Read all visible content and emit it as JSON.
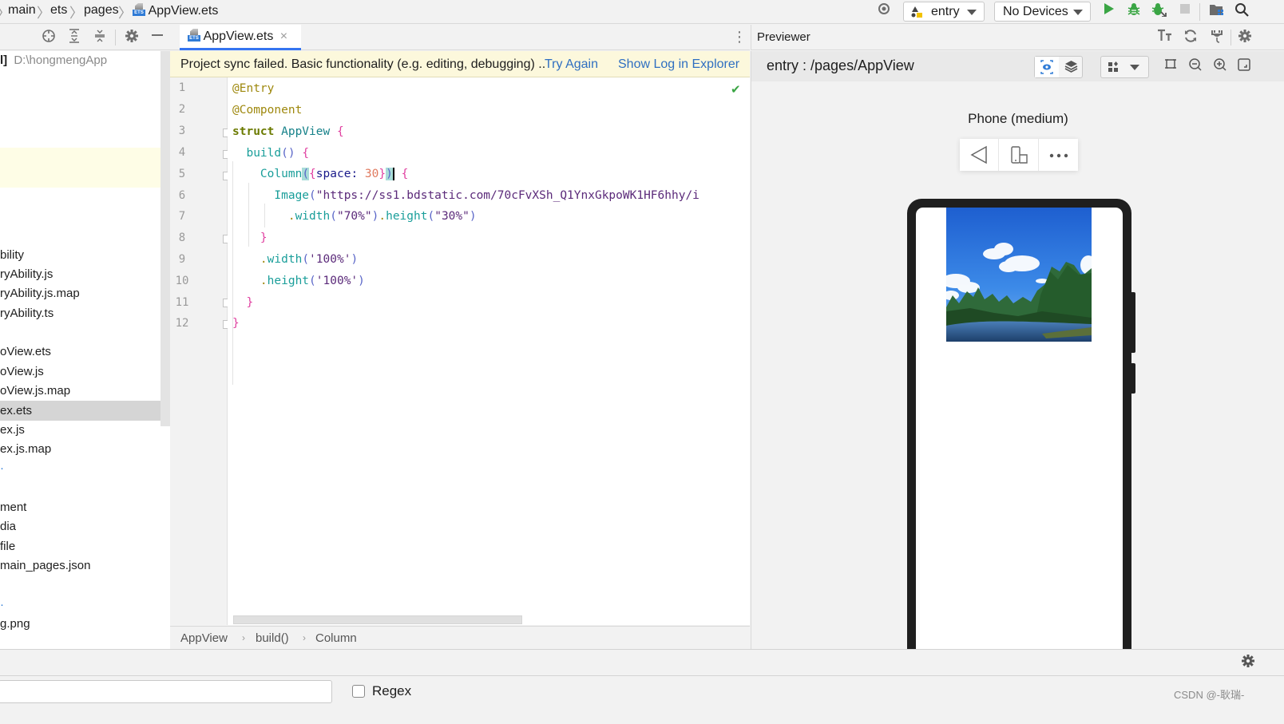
{
  "topbar": {
    "breadcrumb": [
      "main",
      "ets",
      "pages",
      "AppView.ets"
    ],
    "run_config": "entry",
    "device": "No Devices",
    "icons": [
      "target-icon",
      "run-icon",
      "debug-icon",
      "attach-debug-icon",
      "stop-icon",
      "project-structure-icon",
      "search-icon"
    ]
  },
  "sidebar": {
    "toolbar_icons": [
      "locate-icon",
      "expand-all-icon",
      "collapse-all-icon",
      "gear-icon",
      "minimize-icon"
    ],
    "root": {
      "name_fragment": "l]",
      "path": "D:\\hongmengApp"
    },
    "items": [
      "bility",
      "ryAbility.js",
      "ryAbility.js.map",
      "ryAbility.ts",
      "",
      "oView.ets",
      "oView.js",
      "oView.js.map",
      "ex.ets",
      "ex.js",
      "ex.js.map",
      "",
      "",
      "ment",
      "dia",
      "file",
      "main_pages.json",
      "",
      "",
      "g.png"
    ],
    "selected": "ex.ets"
  },
  "editor": {
    "tab": {
      "label": "AppView.ets",
      "close": "×"
    },
    "more_icon": "⋮",
    "banner": {
      "message": "Project sync failed. Basic functionality (e.g. editing, debugging) ..",
      "try_again": "Try Again",
      "show_log": "Show Log in Explorer"
    },
    "line_numbers": [
      "1",
      "2",
      "3",
      "4",
      "5",
      "6",
      "7",
      "8",
      "9",
      "10",
      "11",
      "12"
    ],
    "code": {
      "l1": "@Entry",
      "l2": "@Component",
      "l3_kw": "struct",
      "l3_name": " AppView ",
      "l3_br": "{",
      "l4_fn": "build",
      "l4_p": "()",
      "l4_br": " {",
      "l5_fn": "Column",
      "l5_p1": "(",
      "l5_b1": "{",
      "l5_key": "space",
      "l5_colon": ": ",
      "l5_num": "30",
      "l5_b2": "}",
      "l5_p2": ")",
      "l5_br": " {",
      "l6_fn": "Image",
      "l6_p1": "(",
      "l6_str": "\"https://ss1.bdstatic.com/70cFvXSh_Q1YnxGkpoWK1HF6hhy/i",
      "l7_dot1": ".",
      "l7_fn1": "width",
      "l7_p1": "(",
      "l7_s1": "\"70%\"",
      "l7_p2": ")",
      "l7_dot2": ".",
      "l7_fn2": "height",
      "l7_p3": "(",
      "l7_s2": "\"30%\"",
      "l7_p4": ")",
      "l8": "}",
      "l9_dot": ".",
      "l9_fn": "width",
      "l9_p1": "(",
      "l9_s": "'100%'",
      "l9_p2": ")",
      "l10_dot": ".",
      "l10_fn": "height",
      "l10_p1": "(",
      "l10_s": "'100%'",
      "l10_p2": ")",
      "l11": "}",
      "l12": "}"
    },
    "status_icon": "✔",
    "breadcrumb": [
      "AppView",
      "build()",
      "Column"
    ]
  },
  "previewer": {
    "title": "Previewer",
    "header_icons": [
      "font-size-icon",
      "refresh-icon",
      "plug-icon",
      "gear-icon"
    ],
    "path": "entry : /pages/AppView",
    "toolbar_icons": [
      "inspector-icon",
      "layers-icon",
      "components-icon",
      "dropdown-icon",
      "fit-icon",
      "zoom-out-icon",
      "zoom-in-icon",
      "fullscreen-icon"
    ],
    "device_label": "Phone (medium)",
    "phone_controls": [
      "back-icon",
      "rotate-icon",
      "more-icon"
    ]
  },
  "bottom": {
    "regex_label": "Regex",
    "find_value": "",
    "watermark": "CSDN @-耿瑞-"
  },
  "colors": {
    "accent": "#3574f0",
    "link": "#2f6fc1",
    "banner_bg": "#fcf8dc",
    "run_green": "#3aa544"
  }
}
